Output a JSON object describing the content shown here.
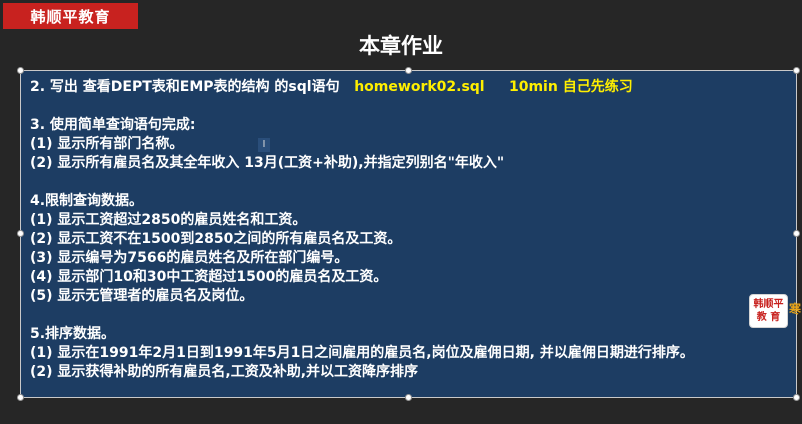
{
  "logo": {
    "text": "韩顺平教育"
  },
  "slide": {
    "title": "本章作业"
  },
  "homework": {
    "q2": {
      "text": "2. 写出 查看DEPT表和EMP表的结构 的sql语句",
      "file": "homework02.sql",
      "time": "10min 自己先练习"
    },
    "q3": {
      "heading": "3. 使用简单查询语句完成:",
      "items": [
        "(1) 显示所有部门名称。",
        "(2) 显示所有雇员名及其全年收入 13月(工资+补助),并指定列别名\"年收入\""
      ]
    },
    "q4": {
      "heading": "4.限制查询数据。",
      "items": [
        "(1) 显示工资超过2850的雇员姓名和工资。",
        "(2) 显示工资不在1500到2850之间的所有雇员名及工资。",
        "(3) 显示编号为7566的雇员姓名及所在部门编号。",
        "(4) 显示部门10和30中工资超过1500的雇员名及工资。",
        "(5) 显示无管理者的雇员名及岗位。"
      ]
    },
    "q5": {
      "heading": "5.排序数据。",
      "items": [
        "(1) 显示在1991年2月1日到1991年5月1日之间雇用的雇员名,岗位及雇佣日期, 并以雇佣日期进行排序。",
        "(2) 显示获得补助的所有雇员名,工资及补助,并以工资降序排序"
      ]
    }
  },
  "cursor": {
    "glyph": "I"
  },
  "badge": {
    "line1": "韩顺平",
    "line2": "教 育",
    "side": "寒"
  }
}
